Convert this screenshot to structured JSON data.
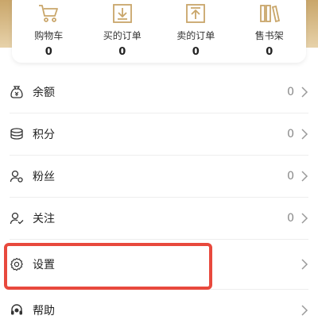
{
  "quick_actions": [
    {
      "label": "购物车",
      "count": "0",
      "icon": "shopping-cart-icon"
    },
    {
      "label": "买的订单",
      "count": "0",
      "icon": "download-order-icon"
    },
    {
      "label": "卖的订单",
      "count": "0",
      "icon": "upload-order-icon"
    },
    {
      "label": "售书架",
      "count": "0",
      "icon": "bookshelf-icon"
    }
  ],
  "menu": [
    {
      "label": "余额",
      "value": "0",
      "icon": "wallet-icon"
    },
    {
      "label": "积分",
      "value": "0",
      "icon": "coins-icon"
    },
    {
      "label": "粉丝",
      "value": "0",
      "icon": "followers-icon"
    },
    {
      "label": "关注",
      "value": "0",
      "icon": "following-icon"
    },
    {
      "label": "设置",
      "value": "",
      "icon": "gear-icon"
    },
    {
      "label": "帮助",
      "value": "",
      "icon": "headset-icon"
    }
  ],
  "colors": {
    "accent_gold": "#c9a66a",
    "highlight_red": "#e8493d"
  }
}
